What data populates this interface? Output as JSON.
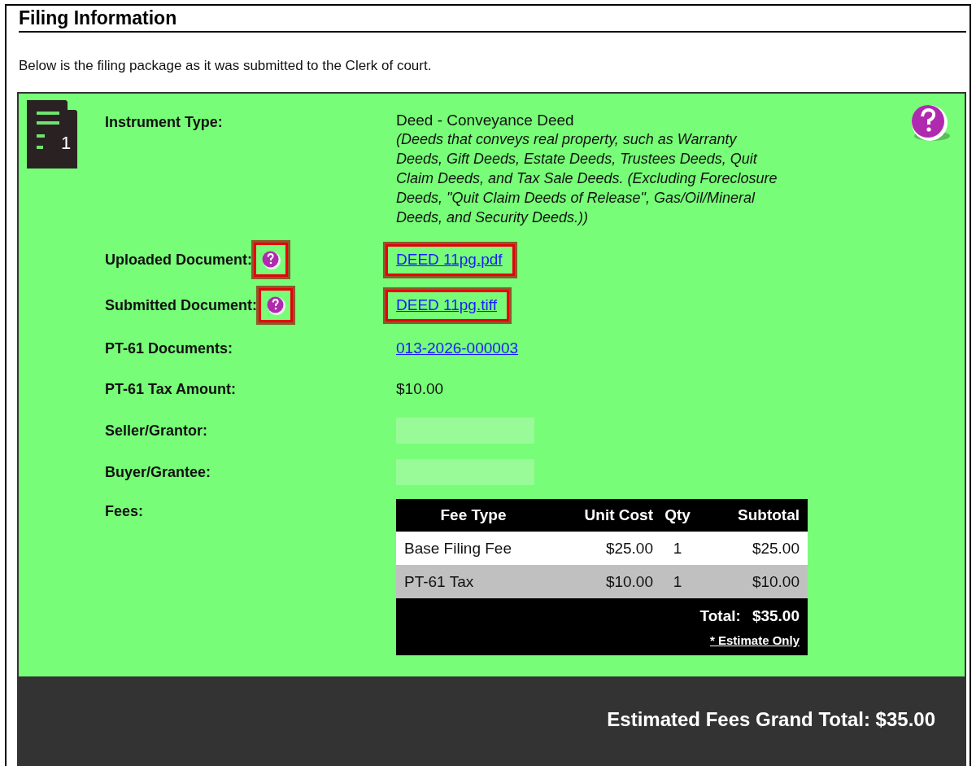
{
  "title": "Filing Information",
  "description": "Below is the filing package as it was submitted to the Clerk of court.",
  "filing": {
    "number": "1",
    "fields": [
      {
        "kind": "instrument",
        "label": "Instrument Type:",
        "value": "Deed - Conveyance Deed",
        "note": "(Deeds that conveys real property, such as Warranty Deeds, Gift Deeds, Estate Deeds, Trustees Deeds, Quit Claim Deeds, and Tax Sale Deeds. (Excluding Foreclosure Deeds, \"Quit Claim Deeds of Release\", Gas/Oil/Mineral Deeds, and Security Deeds.))"
      },
      {
        "kind": "link",
        "label": "Uploaded Document:",
        "help": true,
        "highlighted": true,
        "value": "DEED 11pg.pdf"
      },
      {
        "kind": "link",
        "label": "Submitted Document:",
        "help": true,
        "highlighted": true,
        "value": "DEED 11pg.tiff"
      },
      {
        "kind": "link",
        "label": "PT-61 Documents:",
        "value": "013-2026-000003"
      },
      {
        "kind": "text",
        "label": "PT-61 Tax Amount:",
        "value": "$10.00"
      },
      {
        "kind": "blank",
        "label": "Seller/Grantor:"
      },
      {
        "kind": "blank",
        "label": "Buyer/Grantee:"
      },
      {
        "kind": "fees",
        "label": "Fees:"
      }
    ]
  },
  "fees_table": {
    "columns": [
      "Fee Type",
      "Unit Cost",
      "Qty",
      "Subtotal"
    ],
    "rows": [
      [
        "Base Filing Fee",
        "$25.00",
        "1",
        "$25.00"
      ],
      [
        "PT-61 Tax",
        "$10.00",
        "1",
        "$10.00"
      ]
    ],
    "total_label": "Total:",
    "total_value": "$35.00",
    "footnote": "* Estimate Only"
  },
  "grand_total": "Estimated Fees Grand Total: $35.00"
}
